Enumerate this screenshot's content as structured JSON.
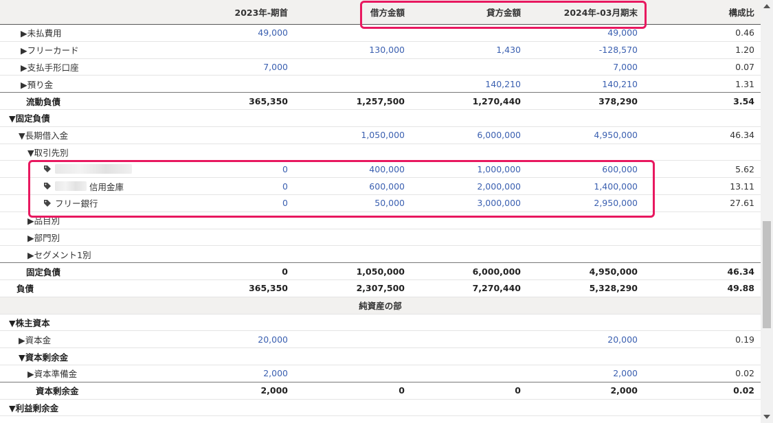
{
  "header": {
    "col1": "2023年-期首",
    "col2": "借方金額",
    "col3": "貸方金額",
    "col4": "2024年-03月期末",
    "col5": "構成比"
  },
  "rows": [
    {
      "label": "▶未払費用",
      "indent": 30,
      "bold": false,
      "total": false,
      "c1": "49,000",
      "c2": "",
      "c3": "",
      "c4": "49,000",
      "c5": "0.46"
    },
    {
      "label": "▶フリーカード",
      "indent": 30,
      "bold": false,
      "total": false,
      "c1": "",
      "c2": "130,000",
      "c3": "1,430",
      "c4": "-128,570",
      "c5": "1.20"
    },
    {
      "label": "▶支払手形口座",
      "indent": 30,
      "bold": false,
      "total": false,
      "c1": "7,000",
      "c2": "",
      "c3": "",
      "c4": "7,000",
      "c5": "0.07"
    },
    {
      "label": "▶預り金",
      "indent": 30,
      "bold": false,
      "total": true,
      "c1": "",
      "c2": "",
      "c3": "140,210",
      "c4": "140,210",
      "c5": "1.31"
    },
    {
      "label": "流動負債",
      "indent": 38,
      "bold": true,
      "total": false,
      "c1": "365,350",
      "c2": "1,257,500",
      "c3": "1,270,440",
      "c4": "378,290",
      "c5": "3.54"
    },
    {
      "label": "▼固定負債",
      "indent": 13,
      "bold": true,
      "total": false,
      "c1": "",
      "c2": "",
      "c3": "",
      "c4": "",
      "c5": ""
    },
    {
      "label": "▼長期借入金",
      "indent": 27,
      "bold": false,
      "total": false,
      "c1": "",
      "c2": "1,050,000",
      "c3": "6,000,000",
      "c4": "4,950,000",
      "c5": "46.34"
    },
    {
      "label": "▼取引先別",
      "indent": 40,
      "bold": false,
      "total": false,
      "c1": "",
      "c2": "",
      "c3": "",
      "c4": "",
      "c5": ""
    },
    {
      "label": "",
      "tag": true,
      "blur": 112,
      "indent": 64,
      "bold": false,
      "total": false,
      "c1": "0",
      "c2": "400,000",
      "c3": "1,000,000",
      "c4": "600,000",
      "c5": "5.62"
    },
    {
      "label": "信用金庫",
      "tag": true,
      "blur": 46,
      "indent": 64,
      "bold": false,
      "total": false,
      "c1": "0",
      "c2": "600,000",
      "c3": "2,000,000",
      "c4": "1,400,000",
      "c5": "13.11"
    },
    {
      "label": "フリー銀行",
      "tag": true,
      "blur": 0,
      "indent": 64,
      "bold": false,
      "total": false,
      "c1": "0",
      "c2": "50,000",
      "c3": "3,000,000",
      "c4": "2,950,000",
      "c5": "27.61"
    },
    {
      "label": "▶品目別",
      "indent": 40,
      "bold": false,
      "total": false,
      "c1": "",
      "c2": "",
      "c3": "",
      "c4": "",
      "c5": ""
    },
    {
      "label": "▶部門別",
      "indent": 40,
      "bold": false,
      "total": false,
      "c1": "",
      "c2": "",
      "c3": "",
      "c4": "",
      "c5": ""
    },
    {
      "label": "▶セグメント1別",
      "indent": 40,
      "bold": false,
      "total": true,
      "c1": "",
      "c2": "",
      "c3": "",
      "c4": "",
      "c5": ""
    },
    {
      "label": "固定負債",
      "indent": 38,
      "bold": true,
      "total": false,
      "c1": "0",
      "c2": "1,050,000",
      "c3": "6,000,000",
      "c4": "4,950,000",
      "c5": "46.34"
    },
    {
      "label": "負債",
      "indent": 24,
      "bold": true,
      "total": false,
      "c1": "365,350",
      "c2": "2,307,500",
      "c3": "7,270,440",
      "c4": "5,328,290",
      "c5": "49.88"
    },
    {
      "section": "純資産の部"
    },
    {
      "label": "▼株主資本",
      "indent": 13,
      "bold": true,
      "total": false,
      "c1": "",
      "c2": "",
      "c3": "",
      "c4": "",
      "c5": ""
    },
    {
      "label": "▶資本金",
      "indent": 27,
      "bold": false,
      "total": false,
      "c1": "20,000",
      "c2": "",
      "c3": "",
      "c4": "20,000",
      "c5": "0.19"
    },
    {
      "label": "▼資本剰余金",
      "indent": 27,
      "bold": true,
      "total": false,
      "c1": "",
      "c2": "",
      "c3": "",
      "c4": "",
      "c5": ""
    },
    {
      "label": "▶資本準備金",
      "indent": 40,
      "bold": false,
      "total": true,
      "c1": "2,000",
      "c2": "",
      "c3": "",
      "c4": "2,000",
      "c5": "0.02"
    },
    {
      "label": "資本剰余金",
      "indent": 52,
      "bold": true,
      "total": false,
      "c1": "2,000",
      "c2": "0",
      "c3": "0",
      "c4": "2,000",
      "c5": "0.02"
    },
    {
      "label": "▼利益剰余金",
      "indent": 13,
      "bold": true,
      "total": false,
      "c1": "",
      "c2": "",
      "c3": "",
      "c4": "",
      "c5": ""
    }
  ],
  "colors": {
    "highlight": "#e8185f",
    "link": "#3a5fb0"
  }
}
